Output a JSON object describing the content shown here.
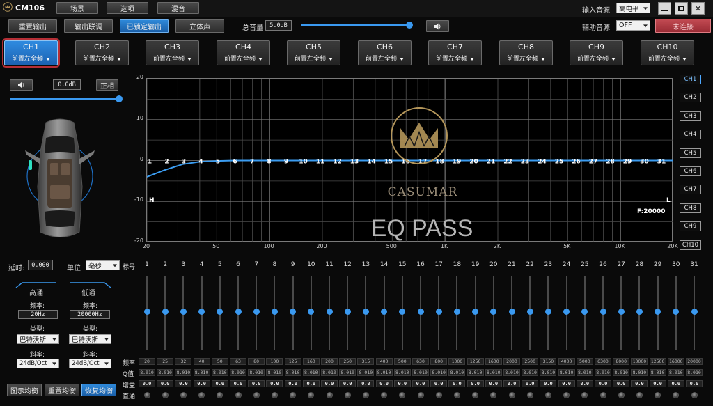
{
  "app": {
    "title": "CM106"
  },
  "topmenu": [
    "场景",
    "选项",
    "混音"
  ],
  "input_source": {
    "label": "输入音源",
    "value": "高电平"
  },
  "aux_source": {
    "label": "辅助音源",
    "value": "OFF"
  },
  "connect_label": "未连接",
  "toolbar": {
    "reset_output": "重置输出",
    "output_link": "输出联调",
    "locked_output": "已锁定输出",
    "stereo": "立体声",
    "master_label": "总音量",
    "master_value": "5.0dB"
  },
  "channels": [
    {
      "name": "CH1",
      "sub": "前置左全频"
    },
    {
      "name": "CH2",
      "sub": "前置左全频"
    },
    {
      "name": "CH3",
      "sub": "前置左全频"
    },
    {
      "name": "CH4",
      "sub": "前置左全频"
    },
    {
      "name": "CH5",
      "sub": "前置左全频"
    },
    {
      "name": "CH6",
      "sub": "前置左全频"
    },
    {
      "name": "CH7",
      "sub": "前置左全频"
    },
    {
      "name": "CH8",
      "sub": "前置左全频"
    },
    {
      "name": "CH9",
      "sub": "前置左全频"
    },
    {
      "name": "CH10",
      "sub": "前置左全频"
    }
  ],
  "active_channel": 0,
  "channel_panel": {
    "gain_value": "0.0dB",
    "phase_label": "正相",
    "delay_label": "延时:",
    "delay_value": "0.000",
    "unit_label": "单位",
    "unit_value": "毫秒",
    "band_label": "标号"
  },
  "filters": {
    "high": {
      "title": "高通",
      "freq_label": "频率:",
      "freq": "20Hz",
      "type_label": "类型:",
      "type": "巴特沃斯",
      "slope_label": "斜率:",
      "slope": "24dB/Oct"
    },
    "low": {
      "title": "低通",
      "freq_label": "频率:",
      "freq": "20000Hz",
      "type_label": "类型:",
      "type": "巴特沃斯",
      "slope_label": "斜率:",
      "slope": "24dB/Oct"
    }
  },
  "bottom_buttons": {
    "graphic": "图示均衡",
    "reset": "重置均衡",
    "restore": "恢复均衡"
  },
  "graph": {
    "y_ticks": [
      "+20",
      "+10",
      "0",
      "-10",
      "-20"
    ],
    "x_ticks": [
      "20",
      "50",
      "100",
      "200",
      "500",
      "1K",
      "2K",
      "5K",
      "10K",
      "20K"
    ],
    "h_marker": "H",
    "l_marker": "L",
    "freq_readout": "F:20000",
    "watermark": "EQ PASS",
    "brand": "CASUMAR",
    "curve": [
      [
        20,
        -4.0
      ],
      [
        25,
        -2.4
      ],
      [
        32,
        -0.9
      ],
      [
        40,
        -0.3
      ],
      [
        50,
        -0.1
      ],
      [
        63,
        0
      ],
      [
        20000,
        0
      ]
    ]
  },
  "right_channels": [
    "CH1",
    "CH2",
    "CH3",
    "CH4",
    "CH5",
    "CH6",
    "CH7",
    "CH8",
    "CH9",
    "CH10"
  ],
  "bands": {
    "numbers": [
      "1",
      "2",
      "3",
      "4",
      "5",
      "6",
      "7",
      "8",
      "9",
      "10",
      "11",
      "12",
      "13",
      "14",
      "15",
      "16",
      "17",
      "18",
      "19",
      "20",
      "21",
      "22",
      "23",
      "24",
      "25",
      "26",
      "27",
      "28",
      "29",
      "30",
      "31"
    ],
    "freqs": [
      "20",
      "25",
      "32",
      "40",
      "50",
      "63",
      "80",
      "100",
      "125",
      "160",
      "200",
      "250",
      "315",
      "400",
      "500",
      "630",
      "800",
      "1000",
      "1250",
      "1600",
      "2000",
      "2500",
      "3150",
      "4000",
      "5000",
      "6300",
      "8000",
      "10000",
      "12500",
      "16000",
      "20000"
    ],
    "q": [
      "8.010",
      "8.010",
      "8.010",
      "8.010",
      "8.010",
      "8.010",
      "8.010",
      "8.010",
      "8.010",
      "8.010",
      "8.010",
      "8.010",
      "8.010",
      "8.010",
      "8.010",
      "8.010",
      "8.010",
      "8.010",
      "8.010",
      "8.010",
      "8.010",
      "8.010",
      "8.010",
      "8.010",
      "8.010",
      "8.010",
      "8.010",
      "8.010",
      "8.010",
      "8.010",
      "8.010"
    ],
    "gains": [
      "0.0",
      "0.0",
      "0.0",
      "0.0",
      "0.0",
      "0.0",
      "0.0",
      "0.0",
      "0.0",
      "0.0",
      "0.0",
      "0.0",
      "0.0",
      "0.0",
      "0.0",
      "0.0",
      "0.0",
      "0.0",
      "0.0",
      "0.0",
      "0.0",
      "0.0",
      "0.0",
      "0.0",
      "0.0",
      "0.0",
      "0.0",
      "0.0",
      "0.0",
      "0.0",
      "0.0"
    ],
    "labels": {
      "freq": "频率",
      "q": "Q值",
      "gain": "增益",
      "direct": "直通"
    }
  },
  "colors": {
    "accent": "#2e88d8",
    "curve": "#3b9cf0",
    "danger": "#b52f36",
    "brand_gold": "#b4965a"
  }
}
